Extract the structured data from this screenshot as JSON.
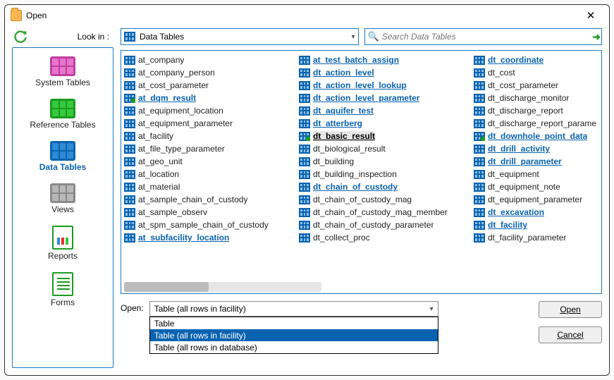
{
  "window": {
    "title": "Open"
  },
  "look_in": {
    "label": "Look in :",
    "value": "Data Tables",
    "search_placeholder": "Search Data Tables"
  },
  "sidebar": {
    "items": [
      {
        "id": "system-tables",
        "label": "System Tables"
      },
      {
        "id": "reference-tables",
        "label": "Reference Tables"
      },
      {
        "id": "data-tables",
        "label": "Data Tables"
      },
      {
        "id": "views",
        "label": "Views"
      },
      {
        "id": "reports",
        "label": "Reports"
      },
      {
        "id": "forms",
        "label": "Forms"
      }
    ],
    "active": "data-tables"
  },
  "tables": {
    "columns": [
      [
        {
          "name": "at_company",
          "link": false
        },
        {
          "name": "at_company_person",
          "link": false
        },
        {
          "name": "at_cost_parameter",
          "link": false
        },
        {
          "name": "at_dqm_result",
          "link": true,
          "mark": true
        },
        {
          "name": "at_equipment_location",
          "link": false
        },
        {
          "name": "at_equipment_parameter",
          "link": false
        },
        {
          "name": "at_facility",
          "link": false
        },
        {
          "name": "at_file_type_parameter",
          "link": false
        },
        {
          "name": "at_geo_unit",
          "link": false
        },
        {
          "name": "at_location",
          "link": false
        },
        {
          "name": "at_material",
          "link": false
        },
        {
          "name": "at_sample_chain_of_custody",
          "link": false
        },
        {
          "name": "at_sample_observ",
          "link": false
        },
        {
          "name": "at_spm_sample_chain_of_custody",
          "link": false
        },
        {
          "name": "at_subfacility_location",
          "link": true
        }
      ],
      [
        {
          "name": "at_test_batch_assign",
          "link": true
        },
        {
          "name": "dt_action_level",
          "link": true
        },
        {
          "name": "dt_action_level_lookup",
          "link": true
        },
        {
          "name": "dt_action_level_parameter",
          "link": true
        },
        {
          "name": "dt_aquifer_test",
          "link": true
        },
        {
          "name": "dt_atterberg",
          "link": true
        },
        {
          "name": "dt_basic_result",
          "link": false,
          "selected": true,
          "mark": true
        },
        {
          "name": "dt_biological_result",
          "link": false
        },
        {
          "name": "dt_building",
          "link": false
        },
        {
          "name": "dt_building_inspection",
          "link": false
        },
        {
          "name": "dt_chain_of_custody",
          "link": true
        },
        {
          "name": "dt_chain_of_custody_mag",
          "link": false
        },
        {
          "name": "dt_chain_of_custody_mag_member",
          "link": false
        },
        {
          "name": "dt_chain_of_custody_parameter",
          "link": false
        },
        {
          "name": "dt_collect_proc",
          "link": false
        }
      ],
      [
        {
          "name": "dt_coordinate",
          "link": true
        },
        {
          "name": "dt_cost",
          "link": false
        },
        {
          "name": "dt_cost_parameter",
          "link": false
        },
        {
          "name": "dt_discharge_monitor",
          "link": false
        },
        {
          "name": "dt_discharge_report",
          "link": false
        },
        {
          "name": "dt_discharge_report_parame",
          "link": false
        },
        {
          "name": "dt_downhole_point_data",
          "link": true,
          "mark": true
        },
        {
          "name": "dt_drill_activity",
          "link": true
        },
        {
          "name": "dt_drill_parameter",
          "link": true
        },
        {
          "name": "dt_equipment",
          "link": false
        },
        {
          "name": "dt_equipment_note",
          "link": false
        },
        {
          "name": "dt_equipment_parameter",
          "link": false
        },
        {
          "name": "dt_excavation",
          "link": true
        },
        {
          "name": "dt_facility",
          "link": true
        },
        {
          "name": "dt_facility_parameter",
          "link": false
        }
      ]
    ]
  },
  "open_as": {
    "label": "Open:",
    "value": "Table (all rows in facility)",
    "options": [
      "Table",
      "Table (all rows in facility)",
      "Table (all rows in database)"
    ],
    "highlighted_index": 1
  },
  "buttons": {
    "open": "Open",
    "cancel": "Cancel"
  }
}
